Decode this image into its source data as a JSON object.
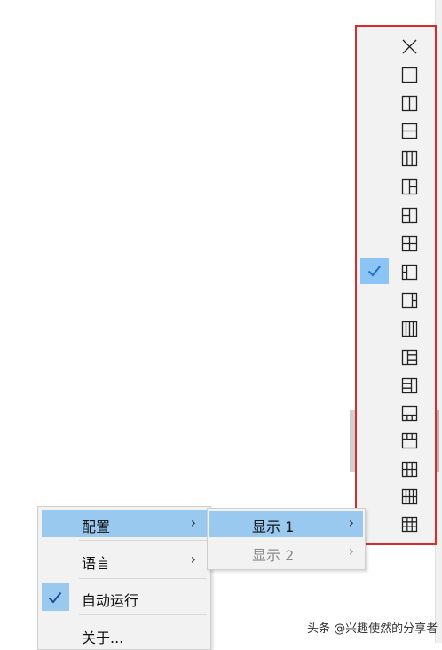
{
  "layout_menu": {
    "items": [
      {
        "icon": "close-icon",
        "checked": false
      },
      {
        "icon": "layout-single-icon",
        "checked": false
      },
      {
        "icon": "layout-2-vertical-icon",
        "checked": false
      },
      {
        "icon": "layout-2-horizontal-icon",
        "checked": false
      },
      {
        "icon": "layout-3-columns-icon",
        "checked": false
      },
      {
        "icon": "layout-1-left-2-right-icon",
        "checked": false
      },
      {
        "icon": "layout-2-left-1-right-icon",
        "checked": false
      },
      {
        "icon": "layout-4-grid-icon",
        "checked": false
      },
      {
        "icon": "layout-sidebar-left-icon",
        "checked": true
      },
      {
        "icon": "layout-sidebar-right-icon",
        "checked": false
      },
      {
        "icon": "layout-4-columns-icon",
        "checked": false
      },
      {
        "icon": "layout-1-left-3-right-icon",
        "checked": false
      },
      {
        "icon": "layout-3-left-1-right-icon",
        "checked": false
      },
      {
        "icon": "layout-3-bottom-icon",
        "checked": false
      },
      {
        "icon": "layout-3-top-icon",
        "checked": false
      },
      {
        "icon": "layout-6-grid-icon",
        "checked": false
      },
      {
        "icon": "layout-8-grid-icon",
        "checked": false
      },
      {
        "icon": "layout-9-grid-icon",
        "checked": false
      }
    ],
    "highlight_color": "#d92b2b"
  },
  "context_menu": {
    "items": [
      {
        "label": "配置",
        "arrow": "›",
        "highlighted": true
      },
      {
        "label": "语言",
        "arrow": "›"
      },
      {
        "label": "自动运行",
        "checked": true
      },
      {
        "label": "关于..."
      }
    ]
  },
  "submenu": {
    "items": [
      {
        "label": "显示 1",
        "arrow": "›",
        "highlighted": true
      },
      {
        "label": "显示 2",
        "arrow": "›",
        "disabled": true
      }
    ]
  },
  "watermark": "头条 @兴趣使然的分享者",
  "colors": {
    "highlight": "#99c9ef",
    "check_bg": "#8cc4f5",
    "check_mark": "#1e6fd0"
  }
}
